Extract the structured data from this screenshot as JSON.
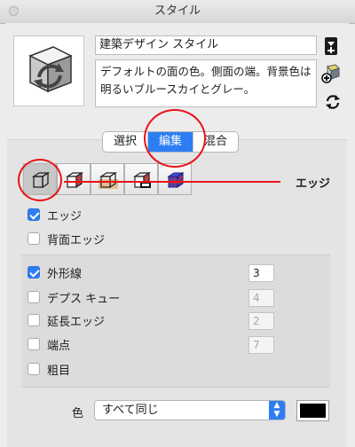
{
  "window": {
    "title": "スタイル"
  },
  "style": {
    "name": "建築デザイン スタイル",
    "description": "デフォルトの面の色。側面の端。背景色は明るいブルースカイとグレー。"
  },
  "tabs": [
    {
      "label": "選択",
      "active": false
    },
    {
      "label": "編集",
      "active": true
    },
    {
      "label": "混合",
      "active": false
    }
  ],
  "toolbar": {
    "buttons": [
      "edge-settings",
      "face-settings",
      "background-settings",
      "watermark-settings",
      "modeling-settings"
    ],
    "active": "edge-settings",
    "section_label": "エッジ"
  },
  "edges": {
    "edges": {
      "label": "エッジ",
      "checked": true
    },
    "back_edges": {
      "label": "背面エッジ",
      "checked": false
    }
  },
  "options": [
    {
      "label": "外形線",
      "checked": true,
      "value": "3",
      "enabled": true
    },
    {
      "label": "デプス キュー",
      "checked": false,
      "value": "4",
      "enabled": false
    },
    {
      "label": "延長エッジ",
      "checked": false,
      "value": "2",
      "enabled": false
    },
    {
      "label": "端点",
      "checked": false,
      "value": "7",
      "enabled": false
    },
    {
      "label": "粗目",
      "checked": false
    }
  ],
  "color": {
    "label": "色",
    "mode": "すべて同じ",
    "swatch": "#000000"
  },
  "colors": {
    "accent": "#2d7ef4",
    "annotation": "#e8141a"
  }
}
